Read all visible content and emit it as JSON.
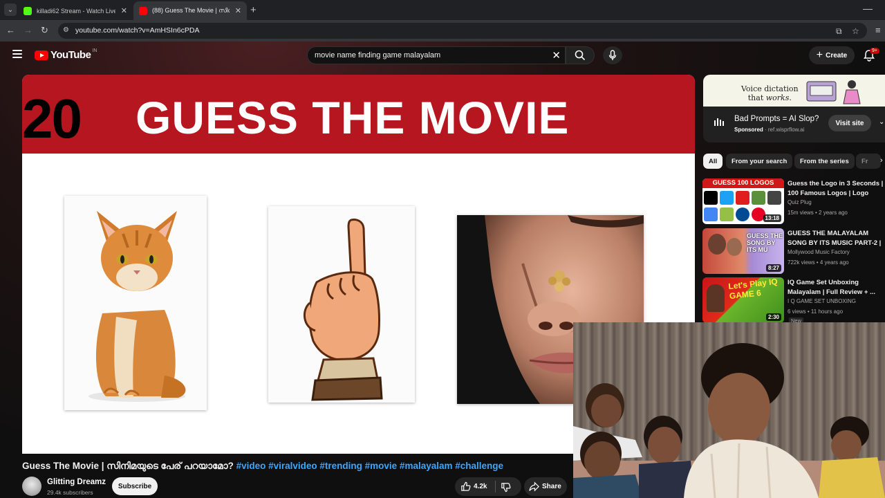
{
  "browser": {
    "tabs": [
      {
        "label": "killadi62 Stream - Watch Live o",
        "favicon_color": "#53fc18",
        "active": false
      },
      {
        "label": "(88) Guess The Movie | സിനിമ",
        "favicon_color": "#ff0000",
        "active": true
      }
    ],
    "url": "youtube.com/watch?v=AmHSIn6cPDA"
  },
  "header": {
    "logo_text": "YouTube",
    "country_code": "IN",
    "search_query": "movie name finding game malayalam",
    "create_label": "Create",
    "notification_count": "9+"
  },
  "video": {
    "banner_number": "20",
    "banner_title": "GUESS THE MOVIE",
    "title": "Guess The Movie | സിനിമയുടെ പേര് പറയാമോ?",
    "hashtags": "#video #viralvideo #trending #movie #malayalam #challenge",
    "channel": "Glitting Dreamz",
    "subscribers": "29.4k subscribers",
    "subscribe_label": "Subscribe",
    "likes": "4.2k",
    "share_label": "Share"
  },
  "ad": {
    "slogan_line1": "Voice dictation",
    "slogan_line2_pre": "that ",
    "slogan_line2_em": "works.",
    "title": "Bad Prompts = AI Slop?",
    "sponsored": "Sponsored",
    "domain": "ref.wisprflow.ai",
    "visit_label": "Visit site"
  },
  "chips": [
    "All",
    "From your search",
    "From the series",
    "Fr"
  ],
  "recommendations": [
    {
      "title": "Guess the Logo in 3 Seconds | 100 Famous Logos | Logo Qui...",
      "channel": "Quiz Plug",
      "meta": "15m views • 2 years ago",
      "duration": "13:18",
      "thumb_text": "GUESS 100 LOGOS"
    },
    {
      "title": "GUESS THE MALAYALAM SONG BY ITS MUSIC PART-2 | ...",
      "channel": "Mollywood Music Factory",
      "meta": "722k views • 4 years ago",
      "duration": "8:27",
      "thumb_text": "GUESS THE SONG BY ITS MU"
    },
    {
      "title": "IQ Game Set Unboxing Malayalam | Full Review + ...",
      "channel": "I Q GAME SET UNBOXING",
      "meta": "6 views • 11 hours ago",
      "duration": "2:30",
      "thumb_text": "Let's Play IQ GAME 6",
      "badge": "New"
    }
  ],
  "colors": {
    "accent": "#ff0000",
    "banner": "#b5161f",
    "link": "#3ea6ff"
  }
}
